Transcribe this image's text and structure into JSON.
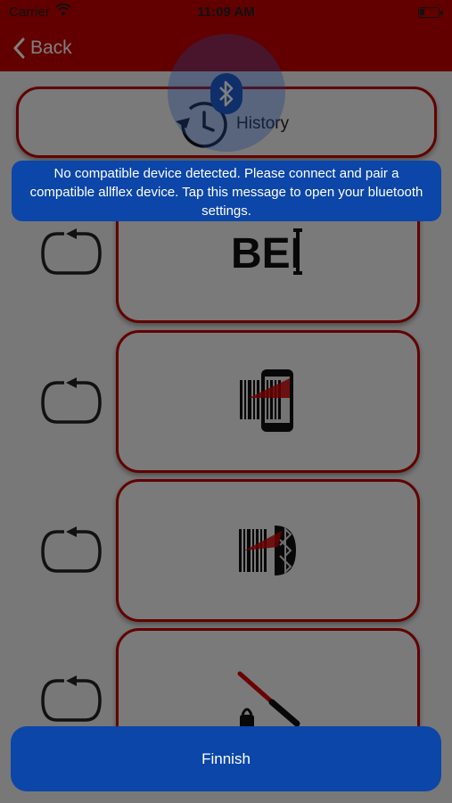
{
  "status_bar": {
    "carrier": "Carrier",
    "time": "11:09 AM"
  },
  "nav": {
    "back_label": "Back"
  },
  "history": {
    "label": "History"
  },
  "banner": {
    "message": "No compatible device detected. Please connect and pair a compatible allflex device. Tap this message to open your bluetooth settings."
  },
  "device_options": [
    {
      "icon": "bei-logo-icon",
      "logo_text": "BEI"
    },
    {
      "icon": "phone-barcode-scanner-icon"
    },
    {
      "icon": "bluetooth-barcode-scanner-icon"
    },
    {
      "icon": "wand-reader-icon"
    }
  ],
  "footer": {
    "finish_label": "Finnish"
  },
  "colors": {
    "nav_red": "#c40000",
    "card_border": "#c40000",
    "button_blue": "#0c46a8",
    "bluetooth_blue": "#1c5fd4"
  }
}
